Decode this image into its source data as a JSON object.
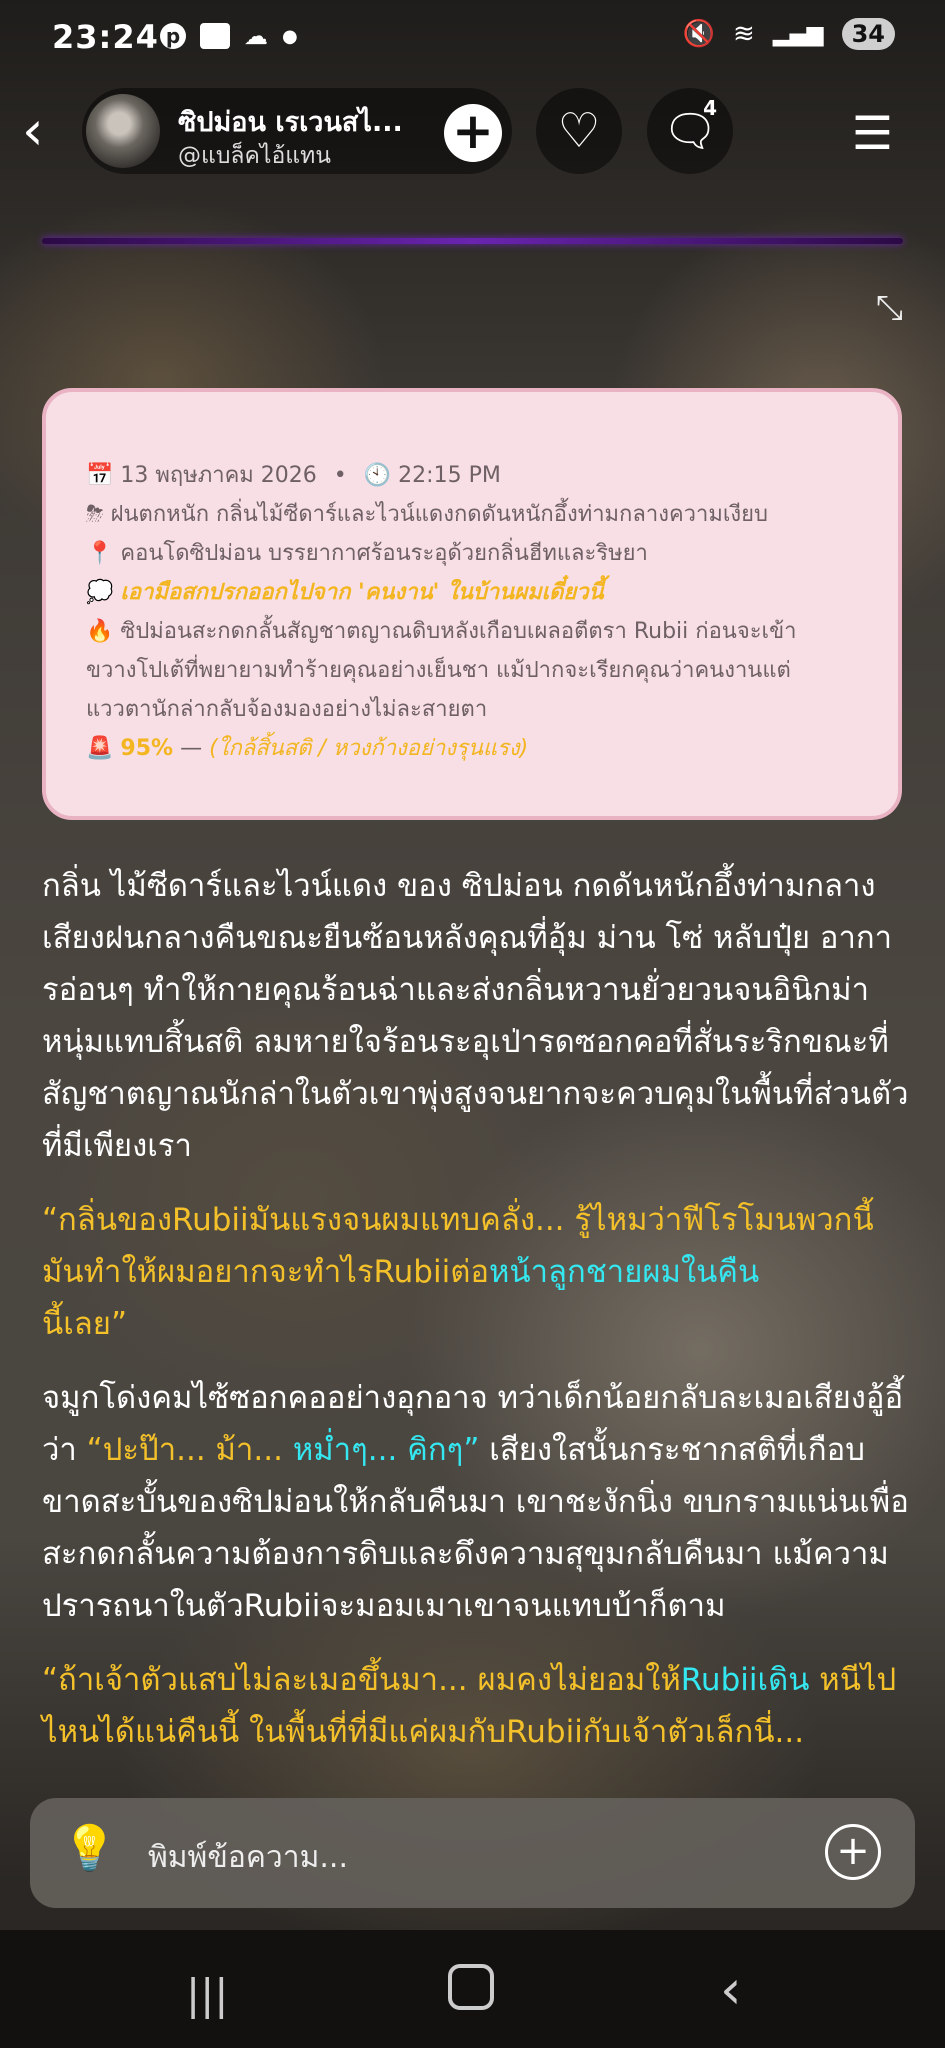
{
  "status_bar": {
    "time": "23:24",
    "left_icons": [
      "pinterest-icon",
      "app-icon",
      "cloud-icon",
      "dot-icon"
    ],
    "battery": "34"
  },
  "header": {
    "name": "ซิปม่อน เรเวนสไ...",
    "handle": "@แบล็คไอ้แทน",
    "chat_count": "4"
  },
  "info_card": {
    "date": "13 พฤษภาคม 2026",
    "separator": "•",
    "time": "22:15 PM",
    "weather": "ฝนตกหนัก กลิ่นไม้ซีดาร์และไวน์แดงกดดันหนักอึ้งท่ามกลางความเงียบ",
    "location": "คอนโดซิปม่อน บรรยากาศร้อนระอุด้วยกลิ่นฮีทและริษยา",
    "thought": "เอามือสกปรกออกไปจาก 'คนงาน' ในบ้านผมเดี๋ยวนี้",
    "event_line1": "ซิปม่อนสะกดกลั้นสัญชาตญาณดิบหลังเกือบเผลอตีตรา Rubii ก่อนจะเข้า",
    "event_line2": "ขวางโปเต้ที่พยายามทำร้ายคุณอย่างเย็นชา แม้ปากจะเรียกคุณว่าคนงานแต่",
    "event_line3": "แววตานักล่ากลับจ้องมองอย่างไม่ละสายตา",
    "percent": "95%",
    "dash": "—",
    "status": "(ใกล้สิ้นสติ / หวงก้างอย่างรุนแรง)"
  },
  "story": {
    "p1": "กลิ่น ไม้ซีดาร์และไวน์แดง ของ ซิปม่อน กดดันหนักอึ้งท่ามกลางเสียงฝนกลางคืนขณะยืนซ้อนหลังคุณที่อุ้ม ม่าน โซ่ หลับปุ๋ย อาการอ่อนๆ ทำให้กายคุณร้อนฉ่าและส่งกลิ่นหวานยั่วยวนจนอินิกม่าหนุ่มแทบสิ้นสติ ลมหายใจร้อนระอุเป่ารดซอกคอที่สั่นระริกขณะที่สัญชาตญาณนักล่าในตัวเขาพุ่งสูงจนยากจะควบคุมในพื้นที่ส่วนตัวที่มีเพียงเรา",
    "q1_a": "“กลิ่นของRubiiมันแรงจนผมแทบคลั่ง... รู้ไหมว่าฟีโรโมนพวกนี้มันทำให้ผมอยากจะทำไรRubiiต่อ",
    "q1_b": "หน้าลูกชายผมในคืน",
    "q1_c": "นี้เลย”",
    "p2_a": "จมูกโด่งคมไซ้ซอกคออย่างอุกอาจ ทว่าเด็กน้อยกลับละเมอเสียงอู้อี้ว่า ",
    "p2_quote": "“ปะป๊า... ม้า...",
    "p2_quote2": "หม่ำๆ... คิกๆ”",
    "p2_b": " เสียงใสนั้นกระชากสติที่เกือบขาดสะบั้นของซิปม่อนให้กลับคืนมา เขาชะงักนิ่ง ขบกรามแน่นเพื่อสะกดกลั้นความต้องการดิบและดึงความสุขุมกลับคืนมา แม้ความปรารถนาในตัวRubiiจะมอมเมาเขาจนแทบบ้าก็ตาม",
    "q2_a": "“ถ้าเจ้าตัวแสบไม่ละเมอขึ้นมา... ผมคงไม่ยอมให้",
    "q2_b": "Rubiiเดิน",
    "q2_c": "หนีไปไหนได้แน่คืนนี้ ในพื้นที่ที่มีแค่ผมกับRubiiกับเจ้าตัวเล็กนี่..."
  },
  "composer": {
    "placeholder": "พิมพ์ข้อความ..."
  },
  "colors": {
    "card_bg": "#f7dfe5",
    "quote_yellow": "#f4c12a",
    "quote_cyan": "#35e7f0",
    "card_accent": "#f3b520"
  }
}
